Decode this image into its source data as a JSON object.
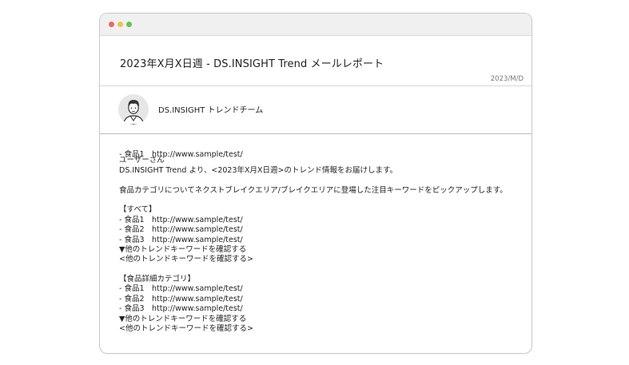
{
  "window": {
    "subject": "2023年X月X日週 - DS.INSIGHT Trend メールレポート",
    "date": "2023/M/D"
  },
  "sender": {
    "name": "DS.INSIGHT トレンドチーム",
    "avatar_icon": "person-avatar-icon"
  },
  "body": {
    "overlap_line": "- 食品1　http://www.sample/test/",
    "greeting": "ユーザーさん",
    "intro": "DS.INSIGHT Trend より、<2023年X月X日週>のトレンド情報をお届けします。",
    "description": "食品カテゴリについてネクストブレイクエリア/ブレイクエリアに登場した注目キーワードをピックアップします。",
    "section_all": {
      "heading": "【すべて】",
      "items": [
        "- 食品1　http://www.sample/test/",
        "- 食品2　http://www.sample/test/",
        "- 食品3　http://www.sample/test/"
      ],
      "more_label": "▼他のトレンドキーワードを確認する",
      "more_link": "<他のトレンドキーワードを確認する>"
    },
    "section_detail": {
      "heading": "【食品詳細カテゴリ】",
      "items": [
        "- 食品1　http://www.sample/test/",
        "- 食品2　http://www.sample/test/",
        "- 食品3　http://www.sample/test/"
      ],
      "more_label": "▼他のトレンドキーワードを確認する",
      "more_link": "<他のトレンドキーワードを確認する>"
    }
  }
}
